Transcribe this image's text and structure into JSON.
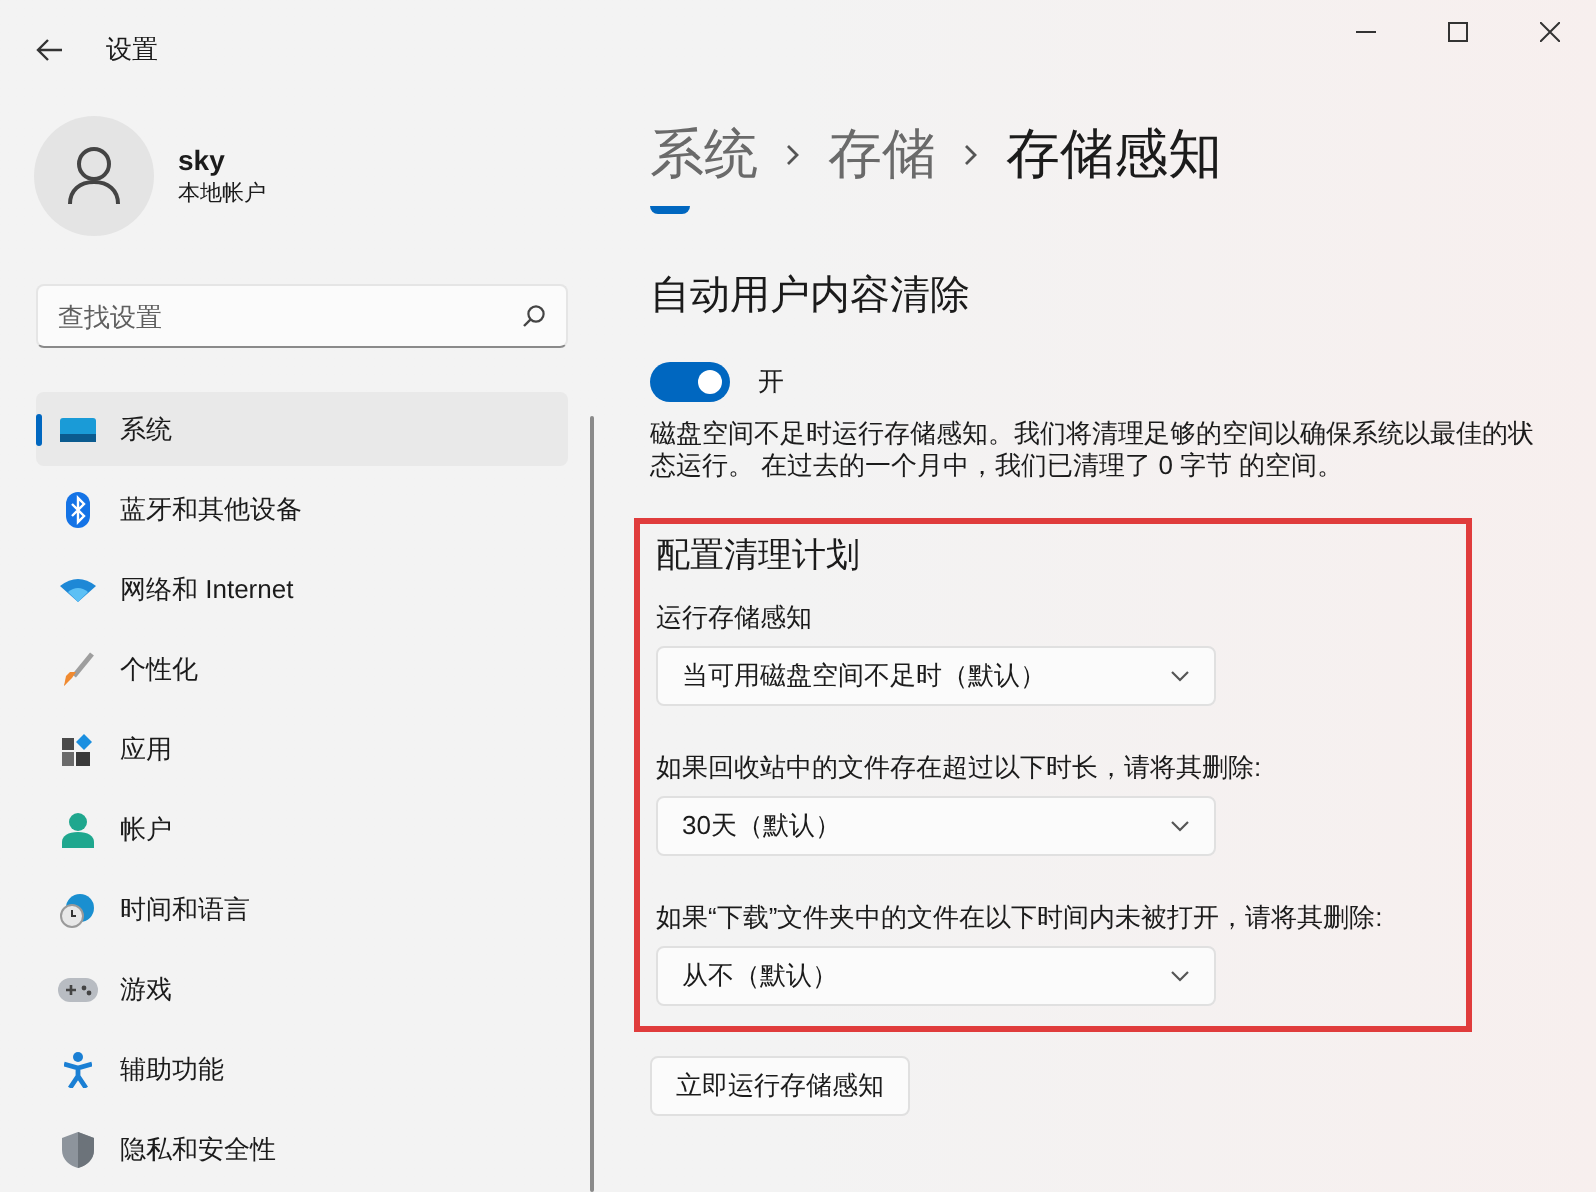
{
  "window": {
    "title": "设置"
  },
  "account": {
    "name": "sky",
    "type": "本地帐户"
  },
  "search": {
    "placeholder": "查找设置"
  },
  "sidebar": {
    "items": [
      {
        "label": "系统",
        "selected": true
      },
      {
        "label": "蓝牙和其他设备",
        "selected": false
      },
      {
        "label": "网络和 Internet",
        "selected": false
      },
      {
        "label": "个性化",
        "selected": false
      },
      {
        "label": "应用",
        "selected": false
      },
      {
        "label": "帐户",
        "selected": false
      },
      {
        "label": "时间和语言",
        "selected": false
      },
      {
        "label": "游戏",
        "selected": false
      },
      {
        "label": "辅助功能",
        "selected": false
      },
      {
        "label": "隐私和安全性",
        "selected": false
      }
    ]
  },
  "breadcrumb": [
    "系统",
    "存储",
    "存储感知"
  ],
  "cleanup": {
    "title": "自动用户内容清除",
    "toggle": {
      "on": true,
      "label": "开"
    },
    "description": "磁盘空间不足时运行存储感知。我们将清理足够的空间以确保系统以最佳的状态运行。 在过去的一个月中，我们已清理了 0 字节 的空间。"
  },
  "schedule": {
    "title": "配置清理计划",
    "highlighted": true,
    "settings": [
      {
        "label": "运行存储感知",
        "value": "当可用磁盘空间不足时（默认）"
      },
      {
        "label": "如果回收站中的文件存在超过以下时长，请将其删除:",
        "value": "30天（默认）"
      },
      {
        "label": "如果“下载”文件夹中的文件在以下时间内未被打开，请将其删除:",
        "value": "从不（默认）"
      }
    ]
  },
  "run_button": {
    "label": "立即运行存储感知"
  }
}
